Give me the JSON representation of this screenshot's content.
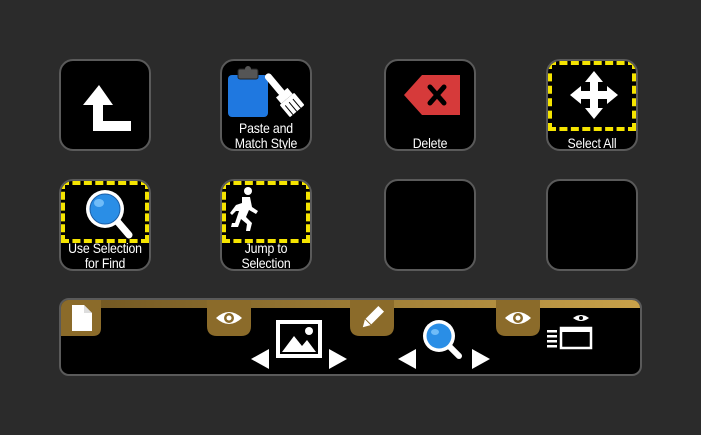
{
  "keys": {
    "back": {
      "label": ""
    },
    "paste_match_style": {
      "label_line1": "Paste and",
      "label_line2": "Match Style"
    },
    "delete": {
      "label": "Delete"
    },
    "select_all": {
      "label": "Select All"
    },
    "use_selection_for_find": {
      "label_line1": "Use Selection",
      "label_line2": "for Find"
    },
    "jump_to_selection": {
      "label_line1": "Jump to",
      "label_line2": "Selection"
    },
    "empty_1": {
      "label": ""
    },
    "empty_2": {
      "label": ""
    }
  },
  "dial_bar": {
    "segments": [
      {
        "id": "document",
        "icon": "document-icon"
      },
      {
        "id": "image",
        "icon": "image-icon",
        "mode_icon": "eye-icon"
      },
      {
        "id": "zoom",
        "icon": "magnifier-icon",
        "mode_icon": "pencil-icon"
      },
      {
        "id": "view",
        "icon": "list-window-icon",
        "mode_icon": "eye-icon"
      }
    ]
  },
  "colors": {
    "background": "#2b2b2b",
    "key_border": "#5a5a5a",
    "highlight_dash": "#f5e400",
    "delete_red": "#d63a3a",
    "clipboard_blue": "#1f78e0",
    "gold": "#8b6b2a",
    "gold_light": "#c9a24a",
    "magnifier_blue": "#2a8ee6"
  }
}
